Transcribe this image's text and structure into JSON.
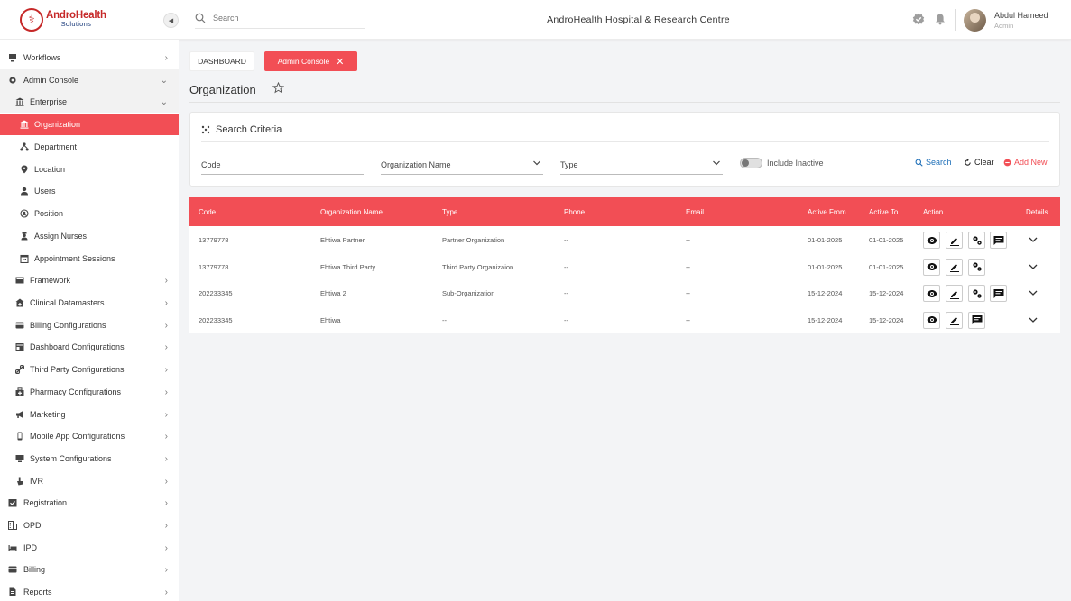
{
  "brand": {
    "name": "AndroHealth",
    "tagline": "Solutions"
  },
  "header": {
    "search_placeholder": "Search",
    "hospital": "AndroHealth Hospital & Research Centre",
    "user_name": "Abdul Hameed",
    "user_role": "Admin"
  },
  "sidebar": {
    "items": [
      {
        "label": "Workflows",
        "icon": "workflow-icon"
      },
      {
        "label": "Admin Console",
        "icon": "gear-icon"
      },
      {
        "label": "Enterprise",
        "icon": "bank-icon"
      },
      {
        "label": "Organization",
        "icon": "organization-icon"
      },
      {
        "label": "Department",
        "icon": "hierarchy-icon"
      },
      {
        "label": "Location",
        "icon": "location-icon"
      },
      {
        "label": "Users",
        "icon": "user-icon"
      },
      {
        "label": "Position",
        "icon": "position-icon"
      },
      {
        "label": "Assign Nurses",
        "icon": "nurse-icon"
      },
      {
        "label": "Appointment Sessions",
        "icon": "calendar-icon"
      },
      {
        "label": "Framework",
        "icon": "framework-icon"
      },
      {
        "label": "Clinical Datamasters",
        "icon": "clinic-icon"
      },
      {
        "label": "Billing Configurations",
        "icon": "card-icon"
      },
      {
        "label": "Dashboard Configurations",
        "icon": "dashboard-icon"
      },
      {
        "label": "Third Party Configurations",
        "icon": "link-icon"
      },
      {
        "label": "Pharmacy Configurations",
        "icon": "pharmacy-icon"
      },
      {
        "label": "Marketing",
        "icon": "megaphone-icon"
      },
      {
        "label": "Mobile App Configurations",
        "icon": "mobile-icon"
      },
      {
        "label": "System Configurations",
        "icon": "system-icon"
      },
      {
        "label": "IVR",
        "icon": "pointer-icon"
      },
      {
        "label": "Registration",
        "icon": "registration-icon"
      },
      {
        "label": "OPD",
        "icon": "building-icon"
      },
      {
        "label": "IPD",
        "icon": "bed-icon"
      },
      {
        "label": "Billing",
        "icon": "billing-icon"
      },
      {
        "label": "Reports",
        "icon": "report-icon"
      }
    ]
  },
  "tabs": {
    "dashboard": "DASHBOARD",
    "admin": "Admin Console",
    "close": "✕"
  },
  "page": {
    "title": "Organization"
  },
  "search_criteria": {
    "title": "Search Criteria",
    "code_label": "Code",
    "org_name_label": "Organization Name",
    "type_label": "Type",
    "include_inactive": "Include Inactive",
    "search": "Search",
    "clear": "Clear",
    "add_new": "Add New"
  },
  "table": {
    "headers": {
      "code": "Code",
      "name": "Organization Name",
      "type": "Type",
      "phone": "Phone",
      "email": "Email",
      "from": "Active From",
      "to": "Active To",
      "action": "Action",
      "details": "Details"
    },
    "rows": [
      {
        "code": "13779778",
        "name": "Ehtiwa  Partner",
        "type": "Partner Organization",
        "phone": "--",
        "email": "--",
        "from": "01-01-2025",
        "to": "01-01-2025"
      },
      {
        "code": "13779778",
        "name": "Ehtiwa  Third Party",
        "type": "Third Party Organizaion",
        "phone": "--",
        "email": "--",
        "from": "01-01-2025",
        "to": "01-01-2025"
      },
      {
        "code": "202233345",
        "name": "Ehtiwa 2",
        "type": "Sub-Organization",
        "phone": "--",
        "email": "--",
        "from": "15-12-2024",
        "to": "15-12-2024"
      },
      {
        "code": "202233345",
        "name": "Ehtiwa",
        "type": "--",
        "phone": "--",
        "email": "--",
        "from": "15-12-2024",
        "to": "15-12-2024"
      }
    ]
  },
  "colors": {
    "accent": "#f24e55",
    "brand_red": "#c62828",
    "brand_blue": "#1a3b7a"
  }
}
